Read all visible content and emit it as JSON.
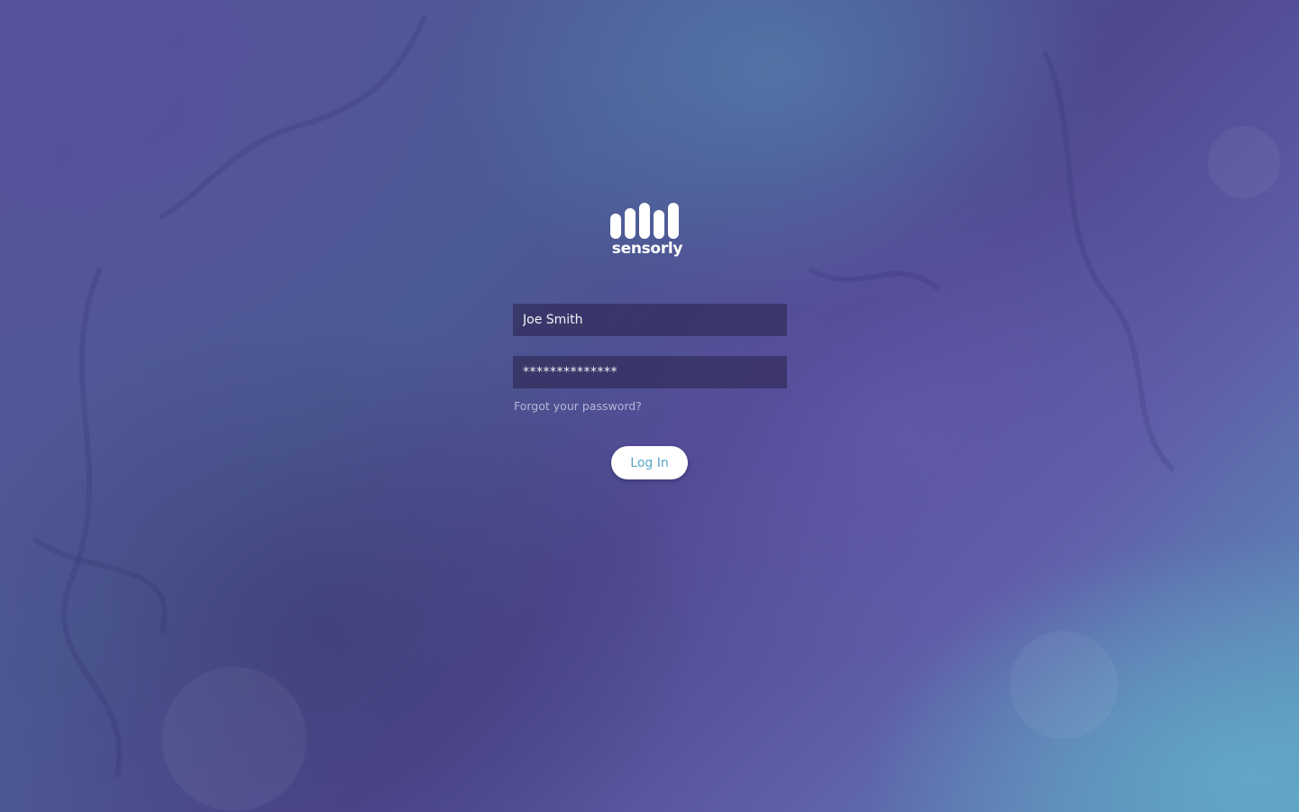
{
  "brand": {
    "name": "sensorly",
    "logo_icon": "signal-bars-icon",
    "logo_color": "#ffffff"
  },
  "login_form": {
    "username_value": "Joe Smith",
    "password_value": "**************",
    "forgot_password_label": "Forgot your password?",
    "login_button_label": "Log In"
  },
  "colors": {
    "accent": "#5aa6c8",
    "field_background": "#322d5a",
    "background_start": "#56529a",
    "background_end": "#5f97bd"
  }
}
